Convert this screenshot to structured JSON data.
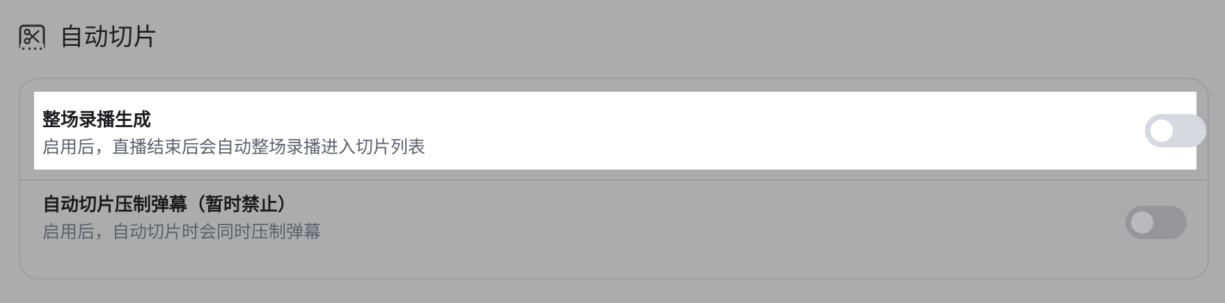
{
  "section": {
    "icon": "scissors-icon",
    "title": "自动切片"
  },
  "settings": [
    {
      "title": "整场录播生成",
      "description": "启用后，直播结束后会自动整场录播进入切片列表",
      "enabled": false,
      "highlighted": true
    },
    {
      "title": "自动切片压制弹幕（暂时禁止）",
      "description": "启用后，自动切片时会同时压制弹幕",
      "enabled": false,
      "highlighted": false
    }
  ],
  "colors": {
    "background": "#acacac",
    "highlight_row": "#ffffff",
    "toggle_off_active": "#d6d9df",
    "toggle_off_dimmed": "#96969b",
    "description_text": "#5d616b"
  }
}
